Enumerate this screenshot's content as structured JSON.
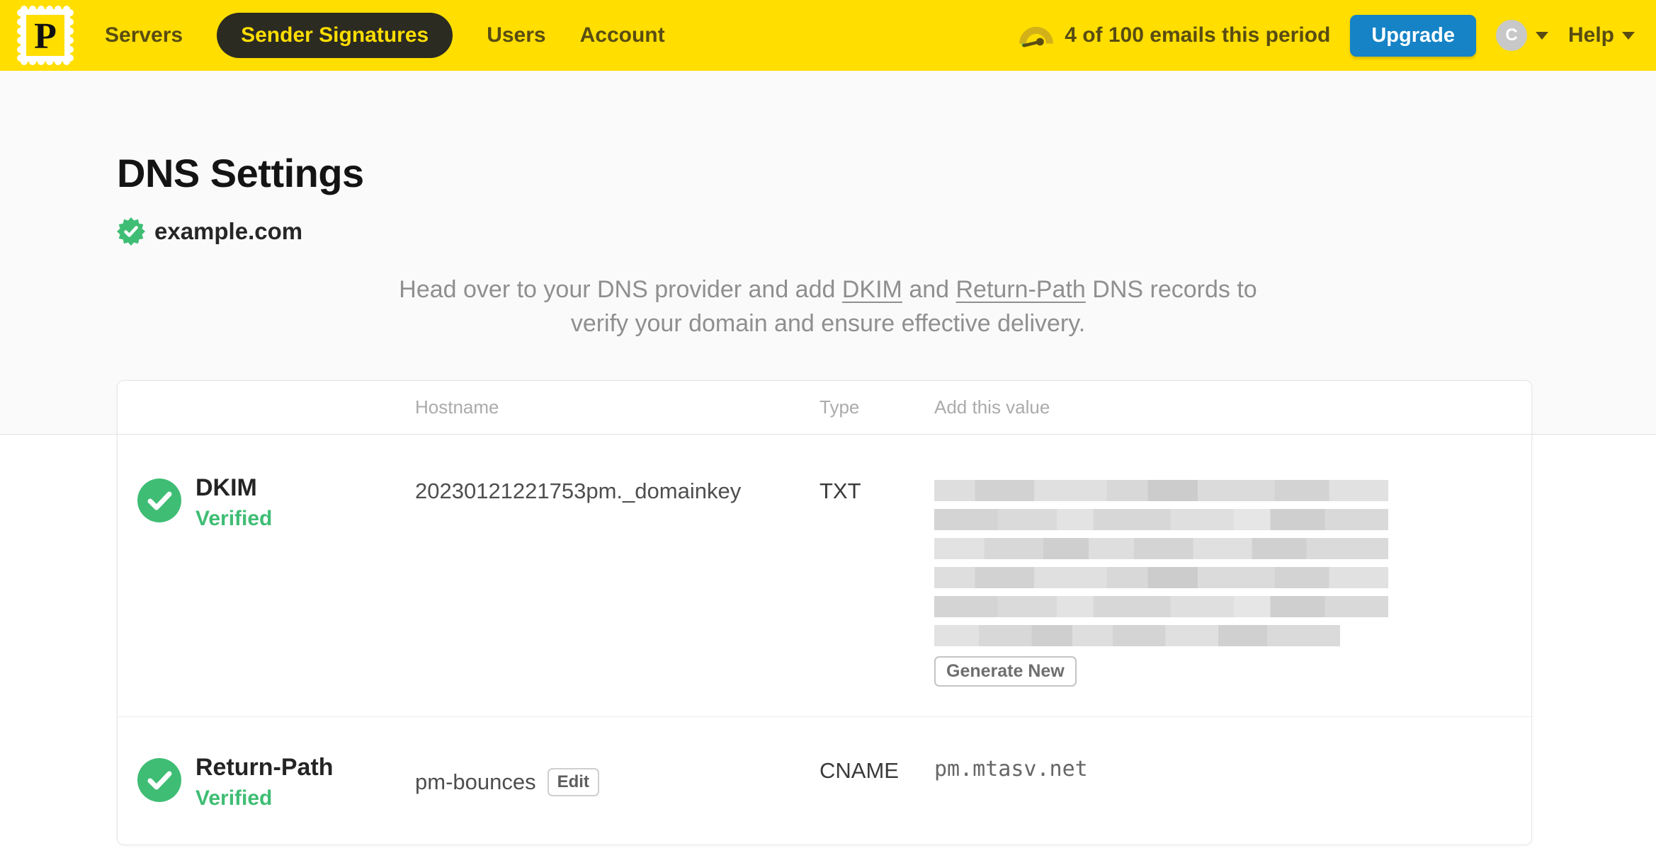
{
  "nav": {
    "logo_letter": "P",
    "items": [
      {
        "label": "Servers",
        "active": false
      },
      {
        "label": "Sender Signatures",
        "active": true
      },
      {
        "label": "Users",
        "active": false
      },
      {
        "label": "Account",
        "active": false
      }
    ],
    "usage": "4 of 100 emails this period",
    "upgrade_label": "Upgrade",
    "avatar_initial": "C",
    "help_label": "Help"
  },
  "page": {
    "title": "DNS Settings",
    "domain": "example.com",
    "description": {
      "part1": "Head over to your DNS provider and add ",
      "link1": "DKIM",
      "part2": " and ",
      "link2": "Return-Path",
      "part3": " DNS records to verify your domain and ensure effective delivery."
    }
  },
  "table": {
    "headers": {
      "hostname": "Hostname",
      "type": "Type",
      "value": "Add this value"
    },
    "rows": [
      {
        "name": "DKIM",
        "status": "Verified",
        "hostname": "20230121221753pm._domainkey",
        "type": "TXT",
        "value_redacted": true,
        "action": "Generate New"
      },
      {
        "name": "Return-Path",
        "status": "Verified",
        "hostname": "pm-bounces",
        "hostname_action": "Edit",
        "type": "CNAME",
        "value": "pm.mtasv.net"
      }
    ]
  },
  "colors": {
    "brand_yellow": "#FFDE00",
    "nav_text": "#584C12",
    "active_pill_bg": "#2B2B22",
    "upgrade_blue": "#1583C6",
    "verified_green": "#3FBD74",
    "description_gray": "#8F8F8F"
  }
}
